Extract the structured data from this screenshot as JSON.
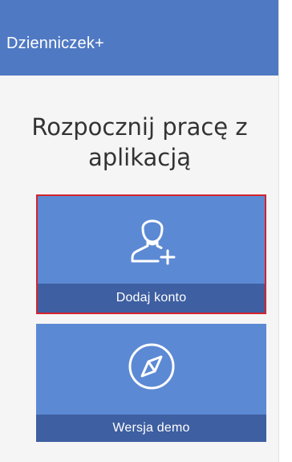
{
  "app_bar": {
    "title": "Dzienniczek+"
  },
  "main": {
    "heading": "Rozpocznij pracę z aplikacją",
    "tiles": [
      {
        "label": "Dodaj konto",
        "icon": "add-user-icon"
      },
      {
        "label": "Wersja demo",
        "icon": "compass-icon"
      }
    ]
  },
  "colors": {
    "app_bar": "#4f79c3",
    "tile": "#5c89d4",
    "tile_label_bar": "#3e5fa1",
    "selected_border": "#d3242f",
    "background": "#f5f5f5"
  }
}
